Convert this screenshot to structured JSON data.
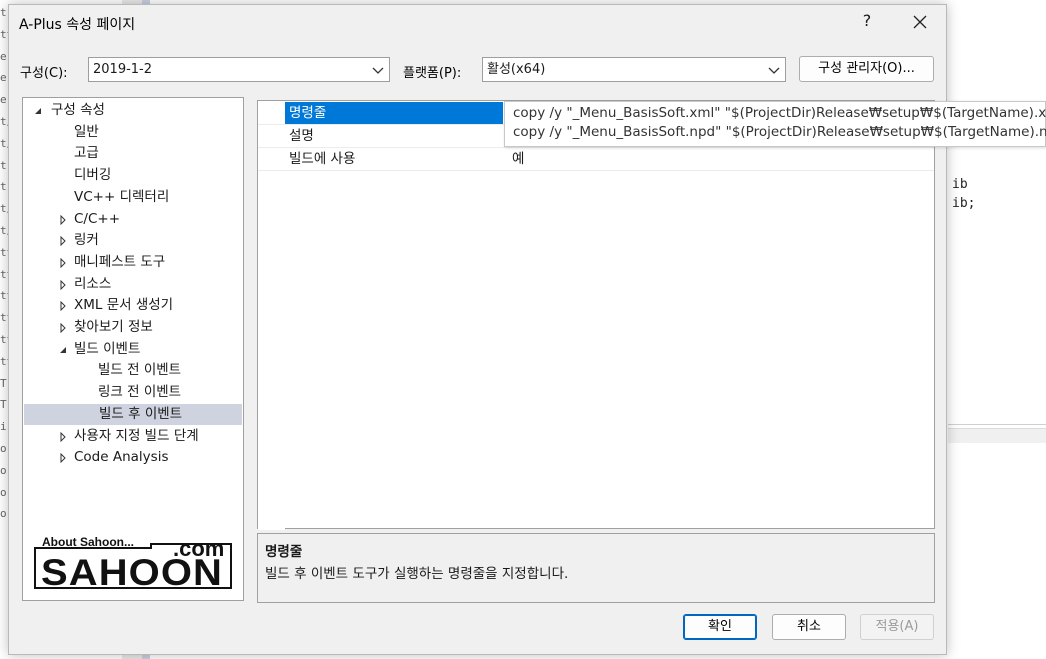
{
  "dialog": {
    "title": "A-Plus 속성 페이지",
    "help": "?",
    "close": "✕"
  },
  "config": {
    "label": "구성(C):",
    "value": "2019-1-2"
  },
  "platform": {
    "label": "플랫폼(P):",
    "value": "활성(x64)"
  },
  "config_manager_label": "구성 관리자(O)...",
  "tree": [
    {
      "label": "구성 속성",
      "level": 0,
      "arrow": "expanded"
    },
    {
      "label": "일반",
      "level": 1,
      "arrow": "none"
    },
    {
      "label": "고급",
      "level": 1,
      "arrow": "none"
    },
    {
      "label": "디버깅",
      "level": 1,
      "arrow": "none"
    },
    {
      "label": "VC++ 디렉터리",
      "level": 1,
      "arrow": "none"
    },
    {
      "label": "C/C++",
      "level": 1,
      "arrow": "collapsed"
    },
    {
      "label": "링커",
      "level": 1,
      "arrow": "collapsed"
    },
    {
      "label": "매니페스트 도구",
      "level": 1,
      "arrow": "collapsed"
    },
    {
      "label": "리소스",
      "level": 1,
      "arrow": "collapsed"
    },
    {
      "label": "XML 문서 생성기",
      "level": 1,
      "arrow": "collapsed"
    },
    {
      "label": "찾아보기 정보",
      "level": 1,
      "arrow": "collapsed"
    },
    {
      "label": "빌드 이벤트",
      "level": 1,
      "arrow": "expanded"
    },
    {
      "label": "빌드 전 이벤트",
      "level": 2,
      "arrow": "none"
    },
    {
      "label": "링크 전 이벤트",
      "level": 2,
      "arrow": "none"
    },
    {
      "label": "빌드 후 이벤트",
      "level": 2,
      "arrow": "none",
      "selected": true
    },
    {
      "label": "사용자 지정 빌드 단계",
      "level": 1,
      "arrow": "collapsed"
    },
    {
      "label": "Code Analysis",
      "level": 1,
      "arrow": "collapsed"
    }
  ],
  "logo": {
    "top": "About Sahoon...",
    "com": ".com",
    "main": "SAHOON"
  },
  "properties": [
    {
      "name": "명령줄",
      "value": "",
      "selected": true
    },
    {
      "name": "설명",
      "value": ""
    },
    {
      "name": "빌드에 사용",
      "value": "예"
    }
  ],
  "tooltip": {
    "line1": "copy /y \"_Menu_BasisSoft.xml\" \"$(ProjectDir)Release₩setup₩$(TargetName).xml\"",
    "line2": "copy /y \"_Menu_BasisSoft.npd\" \"$(ProjectDir)Release₩setup₩$(TargetName).npd\""
  },
  "description": {
    "title": "명령줄",
    "text": "빌드 후 이벤트 도구가 실행하는 명령줄을 지정합니다."
  },
  "buttons": {
    "ok": "확인",
    "cancel": "취소",
    "apply": "적용(A)"
  },
  "background": {
    "left_glyphs": [
      "tr",
      "tt",
      "e",
      "e(",
      "e(",
      "t/",
      "t/",
      "t(",
      "t(",
      "t/",
      "t/",
      "tt",
      "tt",
      "tt",
      "tt",
      "tt",
      "tt",
      "T",
      "T",
      "i",
      "o",
      "o",
      "o",
      "o"
    ],
    "code_lines": [
      "ib",
      "ib;"
    ]
  },
  "colors": {
    "selection": "#0078d7",
    "tree_selection": "#cfd3df",
    "dialog_bg": "#f0f0f0"
  }
}
